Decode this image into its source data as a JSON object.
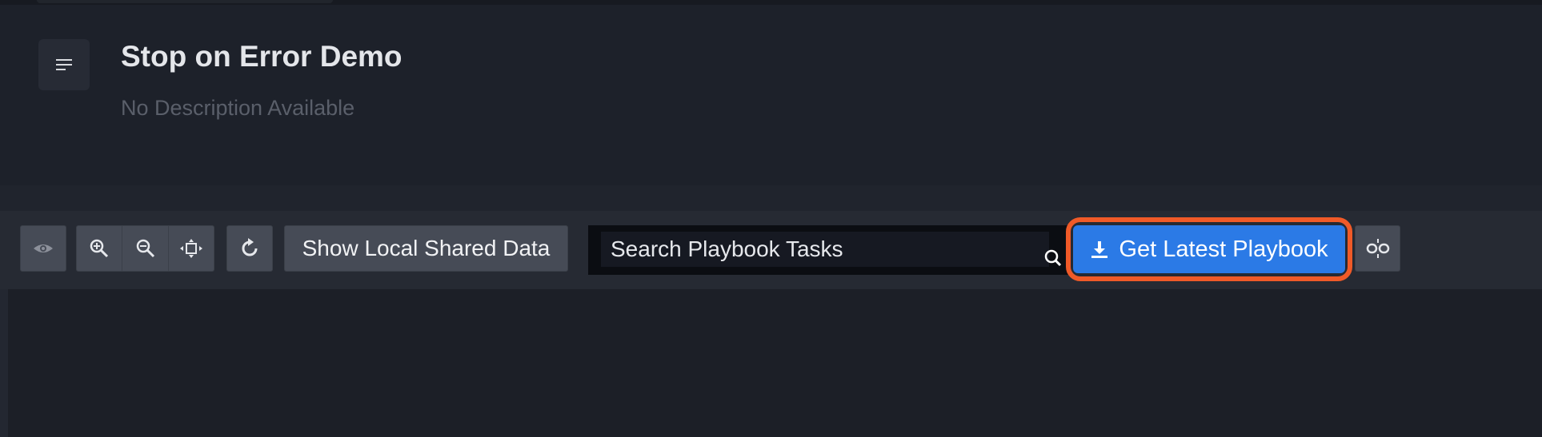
{
  "header": {
    "title": "Stop on Error Demo",
    "description": "No Description Available",
    "menu_icon": "menu-lines-icon"
  },
  "toolbar": {
    "view_icon": "eye-icon",
    "zoom_in_icon": "zoom-in-icon",
    "zoom_out_icon": "zoom-out-icon",
    "fit_icon": "fit-to-screen-icon",
    "refresh_icon": "refresh-icon",
    "show_shared_data_label": "Show Local Shared Data",
    "search": {
      "placeholder": "Search Playbook Tasks",
      "value": "",
      "icon": "search-icon"
    },
    "get_latest_label": "Get Latest Playbook",
    "get_latest_icon": "download-icon",
    "unlink_icon": "unlink-icon"
  },
  "colors": {
    "accent": "#2b7ae6",
    "highlight": "#f05a28",
    "background": "#1c1f27"
  }
}
